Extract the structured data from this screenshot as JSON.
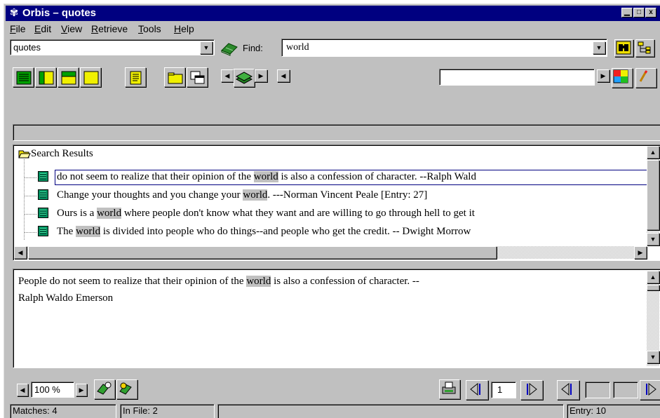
{
  "window": {
    "title": "Orbis – quotes",
    "accent_color": "#000080",
    "controls": {
      "minimize": "▁",
      "maximize": "□",
      "close": "x"
    }
  },
  "menu": [
    {
      "label": "File",
      "mnemonic": "F",
      "rest": "ile"
    },
    {
      "label": "Edit",
      "mnemonic": "E",
      "rest": "dit"
    },
    {
      "label": "View",
      "mnemonic": "V",
      "rest": "iew"
    },
    {
      "label": "Retrieve",
      "mnemonic": "R",
      "rest": "etrieve"
    },
    {
      "label": "Tools",
      "mnemonic": "T",
      "rest": "ools"
    },
    {
      "label": "Help",
      "mnemonic": "H",
      "rest": "elp"
    }
  ],
  "toolbar": {
    "database_value": "quotes",
    "find_label": "Find:",
    "find_value": "world"
  },
  "results": {
    "root_label": "Search Results",
    "items": [
      {
        "before": "do not seem to realize that their opinion of the ",
        "match": "world",
        "after": " is also a confession of character. --Ralph Wald"
      },
      {
        "before": "Change your thoughts and you change your ",
        "match": "world",
        "after": ". ---Norman Vincent Peale  [Entry: 27]"
      },
      {
        "before": "Ours is a ",
        "match": "world",
        "after": " where people don't know what they want and are willing to go through hell to get it"
      },
      {
        "before": "The ",
        "match": "world",
        "after": " is divided into people who do things--and people who get the credit. -- Dwight Morrow"
      }
    ]
  },
  "detail": {
    "before": "People do not seem to realize that their opinion of the ",
    "match": "world",
    "after": " is  also a confession of character. --",
    "line2": "Ralph Waldo Emerson"
  },
  "bottom": {
    "zoom_value": "100 %",
    "page_value": "1"
  },
  "status": {
    "matches": "Matches: 4",
    "in_file": "In File: 2",
    "middle": "",
    "entry": "Entry: 10"
  },
  "icons": [
    "app-icon",
    "book-icon",
    "binoculars-icon",
    "tree-icon",
    "layout-full-icon",
    "layout-left-icon",
    "layout-top-icon",
    "layout-empty-icon",
    "note-icon",
    "folder-icon",
    "window-icon",
    "layers-icon",
    "map-icon",
    "pencil-icon",
    "open-folder-icon",
    "document-icon",
    "bookmark-add-icon",
    "bookmark-icon",
    "print-icon",
    "nav-prev-icon",
    "nav-next-icon"
  ]
}
